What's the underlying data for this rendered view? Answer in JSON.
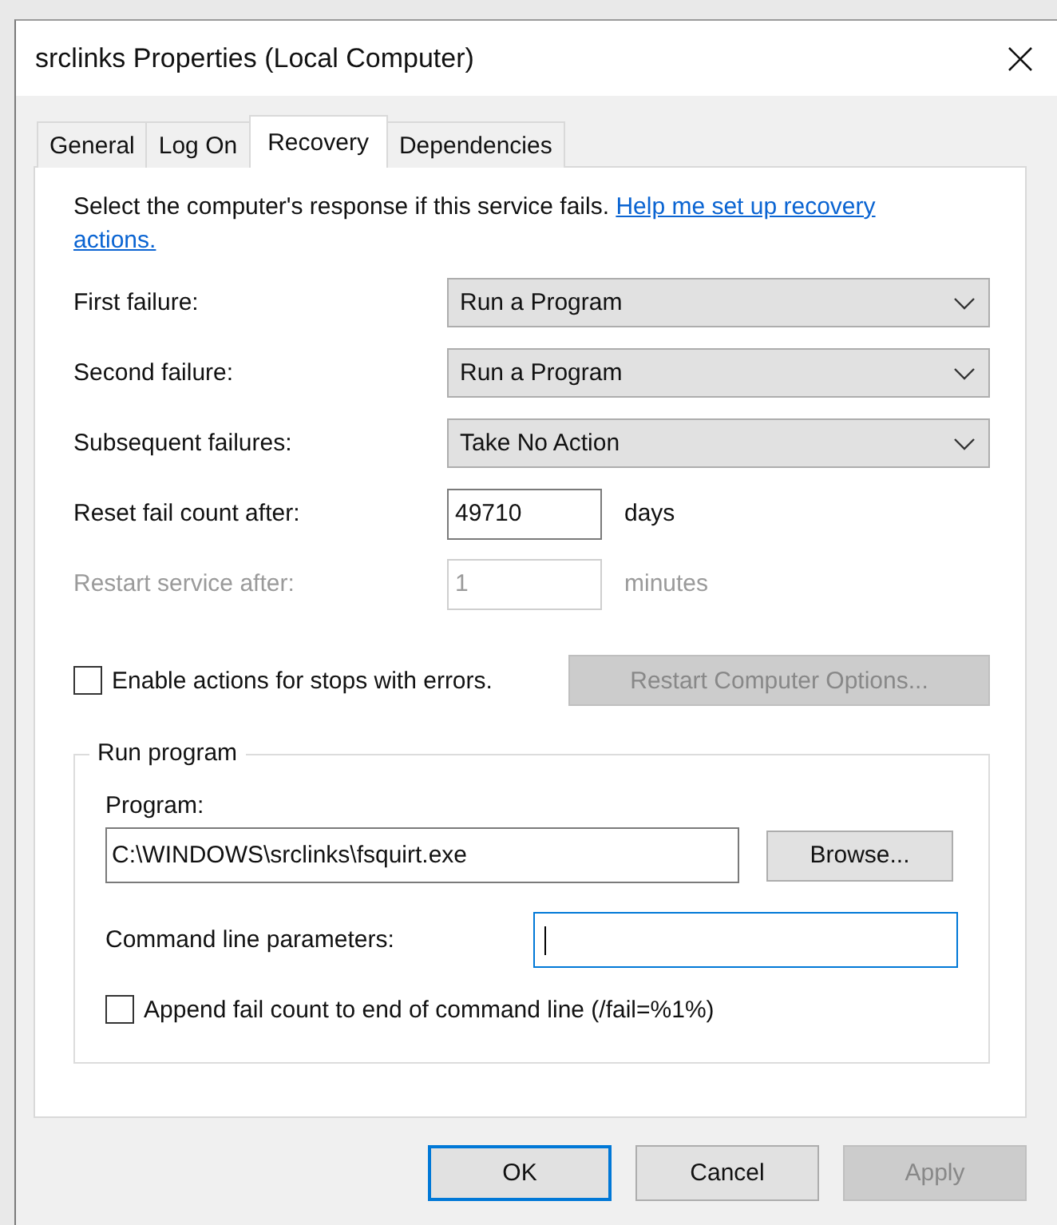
{
  "window": {
    "title": "srclinks Properties (Local Computer)"
  },
  "tabs": [
    {
      "label": "General",
      "selected": false
    },
    {
      "label": "Log On",
      "selected": false
    },
    {
      "label": "Recovery",
      "selected": true
    },
    {
      "label": "Dependencies",
      "selected": false
    }
  ],
  "intro": {
    "text": "Select the computer's response if this service fails.",
    "link_lines": [
      "Help me set up recovery",
      "actions."
    ]
  },
  "settings": [
    {
      "kind": "dropdown",
      "label": "First failure:",
      "value": "Run a Program",
      "disabled": false
    },
    {
      "kind": "dropdown",
      "label": "Second failure:",
      "value": "Run a Program",
      "disabled": false
    },
    {
      "kind": "dropdown",
      "label": "Subsequent failures:",
      "value": "Take No Action",
      "disabled": false
    },
    {
      "kind": "number",
      "label": "Reset fail count after:",
      "value": "49710",
      "unit": "days",
      "disabled": false
    },
    {
      "kind": "number",
      "label": "Restart service after:",
      "value": "1",
      "unit": "minutes",
      "disabled": true
    }
  ],
  "enable_actions": {
    "label": "Enable actions for stops with errors.",
    "checked": false
  },
  "restart_options_button": {
    "label": "Restart Computer Options...",
    "disabled": true
  },
  "run_program": {
    "title": "Run program",
    "program_label": "Program:",
    "program_value": "C:\\WINDOWS\\srclinks\\fsquirt.exe",
    "browse": "Browse...",
    "params_label": "Command line parameters:",
    "params_focused": true,
    "append": {
      "label": "Append fail count to end of command line (/fail=%1%)",
      "checked": false
    }
  },
  "buttons": [
    {
      "label": "OK",
      "default": true,
      "disabled": false
    },
    {
      "label": "Cancel",
      "default": false,
      "disabled": false
    },
    {
      "label": "Apply",
      "default": false,
      "disabled": true
    }
  ]
}
